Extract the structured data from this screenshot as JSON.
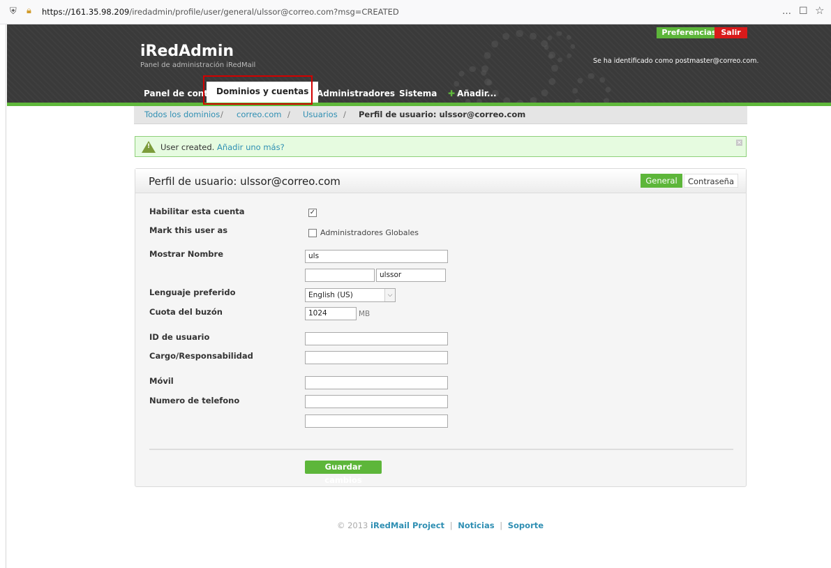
{
  "browser": {
    "url_host": "https://161.35.98.209",
    "url_path": "/iredadmin/profile/user/general/ulssor@correo.com?msg=CREATED",
    "icons": [
      "shield-icon",
      "lock-icon",
      "menu-dots-icon",
      "pocket-icon",
      "star-icon"
    ]
  },
  "header": {
    "title": "iRedAdmin",
    "subtitle": "Panel de administración iRedMail",
    "preferences_label": "Preferencias",
    "logout_label": "Salir",
    "identity": "Se ha identificado como postmaster@correo.com."
  },
  "nav": {
    "items": [
      {
        "label": "Panel de control"
      },
      {
        "label": "Dominios y cuentas"
      },
      {
        "label": "Administradores"
      },
      {
        "label": "Sistema"
      },
      {
        "label": "Añadir..."
      }
    ]
  },
  "breadcrumb": {
    "items": [
      "Todos los dominios",
      "correo.com",
      "Usuarios"
    ],
    "separator": "/",
    "current": "Perfil de usuario: ulssor@correo.com"
  },
  "notice": {
    "text": "User created.",
    "link": "Añadir uno más?"
  },
  "panel": {
    "title": "Perfil de usuario: ulssor@correo.com",
    "tabs": [
      "General",
      "Contraseña"
    ]
  },
  "form": {
    "enable_label": "Habilitar esta cuenta",
    "enable_checked": true,
    "mark_label": "Mark this user as",
    "global_admin_label": "Administradores Globales",
    "global_admin_checked": false,
    "display_name_label": "Mostrar Nombre",
    "display_name_value": "uls",
    "first_name_value": "",
    "last_name_value": "ulssor",
    "language_label": "Lenguaje preferido",
    "language_value": "English (US)",
    "quota_label": "Cuota del buzón",
    "quota_value": "1024",
    "quota_unit": "MB",
    "user_id_label": "ID de usuario",
    "user_id_value": "",
    "job_label": "Cargo/Responsabilidad",
    "job_value": "",
    "mobile_label": "Móvil",
    "mobile_value": "",
    "phone_label": "Numero de telefono",
    "phone_value": "",
    "phone2_value": "",
    "save_label": "Guardar cambios"
  },
  "footer": {
    "copyright": "© 2013",
    "project": "iRedMail Project",
    "news": "Noticias",
    "support": "Soporte",
    "separator": "|"
  },
  "colors": {
    "green": "#5db63a",
    "red": "#d91a1a",
    "header_bg": "#3a3a3a",
    "link": "#2f8fb3"
  }
}
